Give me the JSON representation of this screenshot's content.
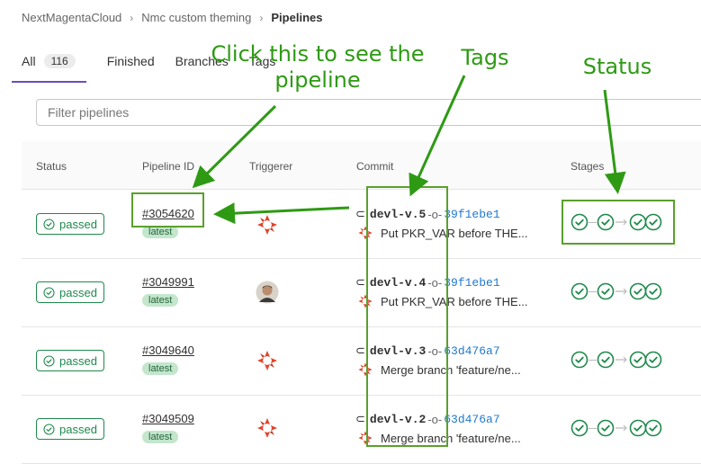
{
  "breadcrumb": {
    "group": "NextMagentaCloud",
    "project": "Nmc custom theming",
    "current": "Pipelines"
  },
  "tabs": [
    {
      "label": "All",
      "count": "116"
    },
    {
      "label": "Finished"
    },
    {
      "label": "Branches"
    },
    {
      "label": "Tags"
    }
  ],
  "filter": {
    "placeholder": "Filter pipelines"
  },
  "columns": {
    "status": "Status",
    "pipeline_id": "Pipeline ID",
    "triggerer": "Triggerer",
    "commit": "Commit",
    "stages": "Stages"
  },
  "rows": [
    {
      "status": "passed",
      "id": "#3054620",
      "latest": "latest",
      "tag": "devl-v.5",
      "sha": "39f1ebe1",
      "message": "Put PKR_VAR before THE...",
      "triggerer": "logo-avatar-icon"
    },
    {
      "status": "passed",
      "id": "#3049991",
      "latest": "latest",
      "tag": "devl-v.4",
      "sha": "39f1ebe1",
      "message": "Put PKR_VAR before THE...",
      "triggerer": "user-photo-avatar"
    },
    {
      "status": "passed",
      "id": "#3049640",
      "latest": "latest",
      "tag": "devl-v.3",
      "sha": "63d476a7",
      "message": "Merge branch 'feature/ne...",
      "triggerer": "logo-avatar-icon"
    },
    {
      "status": "passed",
      "id": "#3049509",
      "latest": "latest",
      "tag": "devl-v.2",
      "sha": "63d476a7",
      "message": "Merge branch 'feature/ne...",
      "triggerer": "logo-avatar-icon"
    }
  ],
  "annotations": {
    "click": "Click this to see the pipeline",
    "tags": "Tags",
    "status": "Status"
  },
  "colors": {
    "success": "#1f8a4c",
    "active_tab": "#6b4fbb",
    "link_sha": "#1f78d1",
    "annotation": "#2e9a14",
    "latest_bg": "#c3e6cd"
  }
}
